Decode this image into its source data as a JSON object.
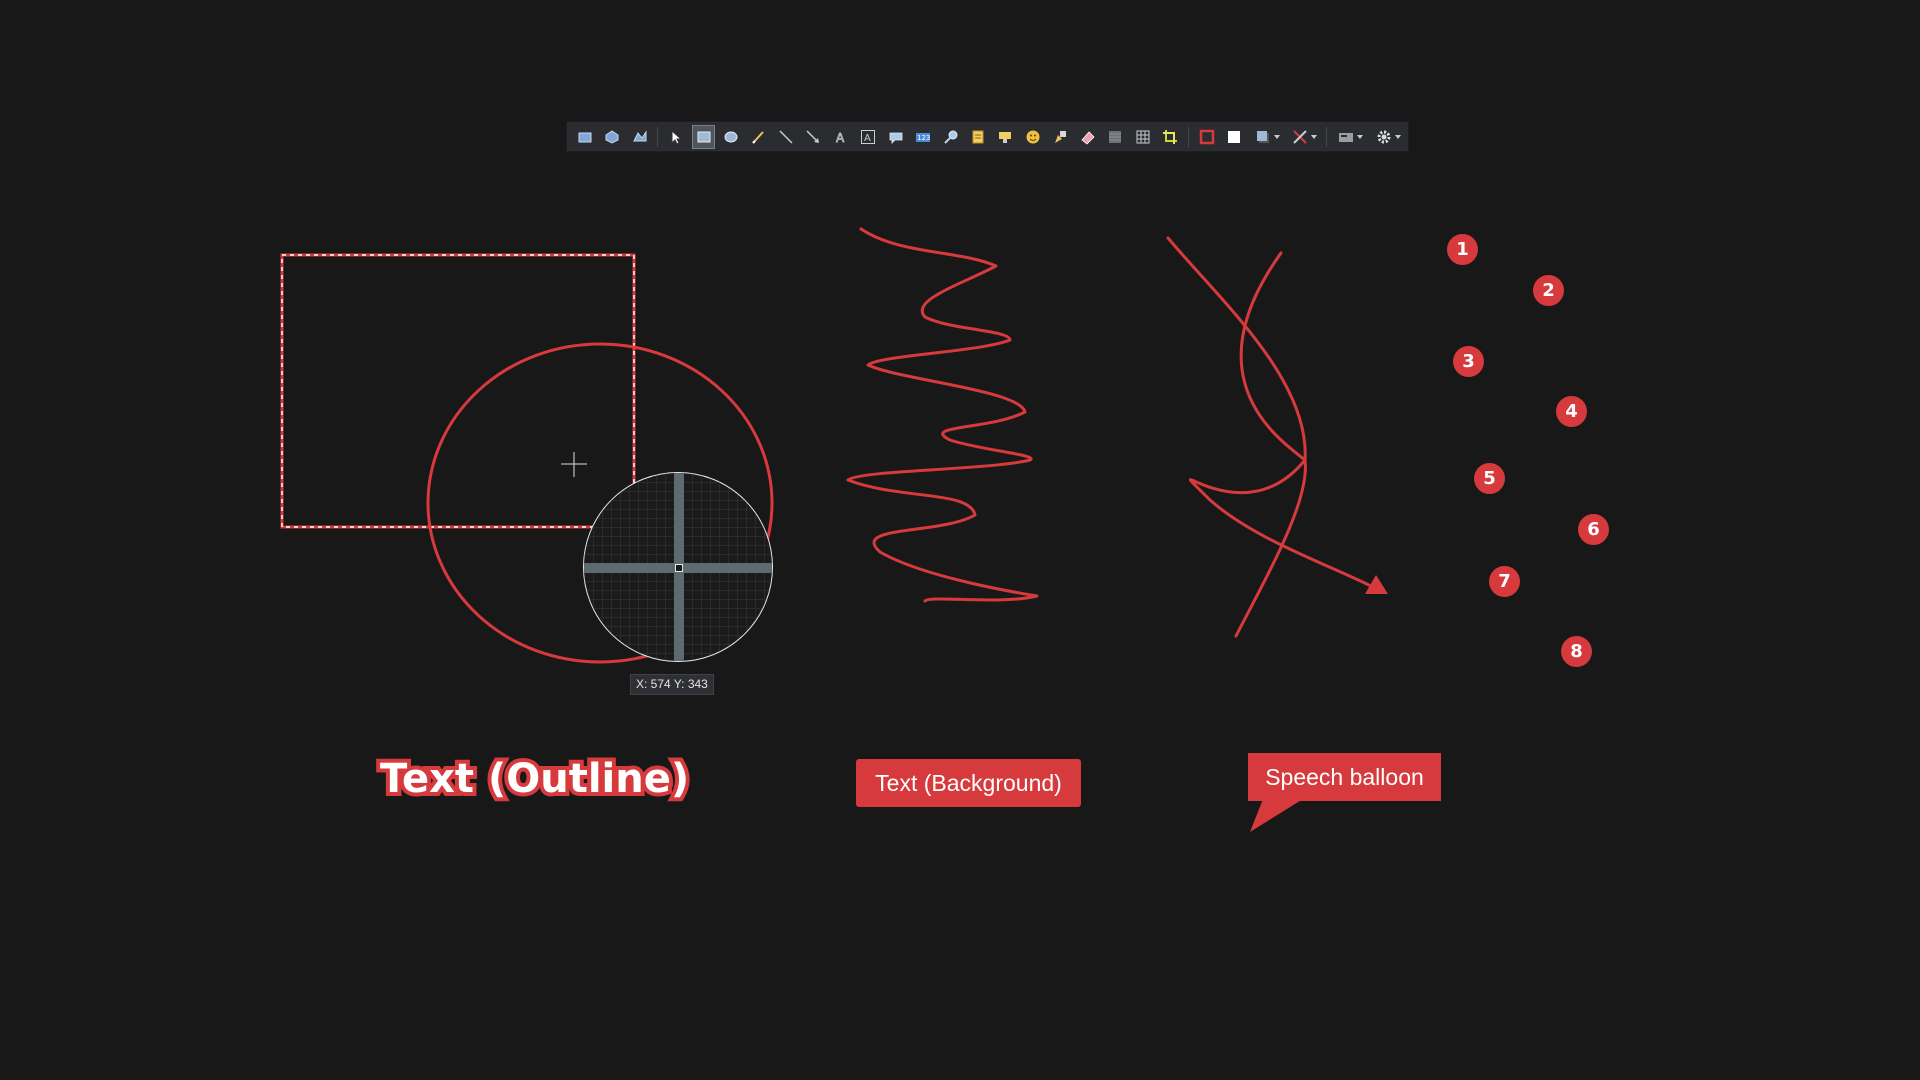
{
  "toolbar": {
    "tools": [
      {
        "icon": "capture-region-icon"
      },
      {
        "icon": "capture-window-icon"
      },
      {
        "icon": "capture-freehand-icon"
      },
      {
        "icon": "select-pointer-icon"
      },
      {
        "icon": "rectangle-icon",
        "active": true
      },
      {
        "icon": "ellipse-icon"
      },
      {
        "icon": "freehand-pen-icon"
      },
      {
        "icon": "line-icon"
      },
      {
        "icon": "arrow-icon"
      },
      {
        "icon": "text-outline-icon"
      },
      {
        "icon": "text-background-icon"
      },
      {
        "icon": "speech-balloon-icon"
      },
      {
        "icon": "step-counter-icon"
      },
      {
        "icon": "magnify-icon"
      },
      {
        "icon": "sticker-icon"
      },
      {
        "icon": "highlight-icon"
      },
      {
        "icon": "emoji-icon"
      },
      {
        "icon": "cursor-icon"
      },
      {
        "icon": "eraser-icon"
      },
      {
        "icon": "blur-icon"
      },
      {
        "icon": "pixelate-icon"
      },
      {
        "icon": "crop-icon"
      }
    ],
    "right_tools": [
      {
        "icon": "border-color-icon",
        "dropdown": false
      },
      {
        "icon": "fill-color-icon",
        "dropdown": false
      },
      {
        "icon": "shadow-icon",
        "dropdown": true
      },
      {
        "icon": "tools-icon",
        "dropdown": true
      },
      {
        "icon": "task-icon",
        "dropdown": true
      },
      {
        "icon": "settings-gear-icon",
        "dropdown": true
      }
    ]
  },
  "magnifier": {
    "coords_label": "X: 574 Y: 343"
  },
  "annotations": {
    "text_outline": "Text (Outline)",
    "text_background": "Text (Background)",
    "speech_balloon": "Speech balloon"
  },
  "step_labels": [
    "1",
    "2",
    "3",
    "4",
    "5",
    "6",
    "7",
    "8"
  ],
  "colors": {
    "annotation": "#d63a3d",
    "canvas_background": "#181818",
    "toolbar_background": "#2a2c30"
  }
}
